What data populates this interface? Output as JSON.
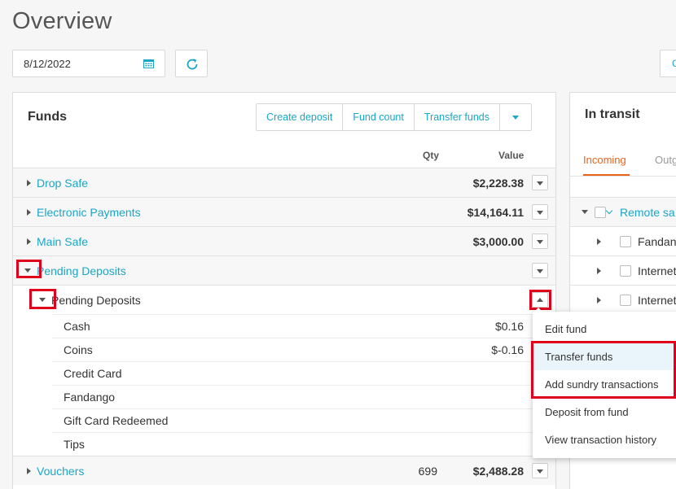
{
  "page": {
    "title": "Overview"
  },
  "toolbar": {
    "date_value": "8/12/2022",
    "edge_button_label": "C"
  },
  "funds": {
    "title": "Funds",
    "buttons": {
      "create_deposit": "Create deposit",
      "fund_count": "Fund count",
      "transfer_funds": "Transfer funds"
    },
    "columns": {
      "qty": "Qty",
      "value": "Value"
    },
    "rows": [
      {
        "label": "Drop Safe",
        "qty": "",
        "value": "$2,228.38"
      },
      {
        "label": "Electronic Payments",
        "qty": "",
        "value": "$14,164.11"
      },
      {
        "label": "Main Safe",
        "qty": "",
        "value": "$3,000.00"
      },
      {
        "label": "Pending Deposits",
        "qty": "",
        "value": ""
      }
    ],
    "sub_group": {
      "label": "Pending Deposits"
    },
    "items": [
      {
        "label": "Cash",
        "value": "$0.16"
      },
      {
        "label": "Coins",
        "value": "$-0.16"
      },
      {
        "label": "Credit Card",
        "value": ""
      },
      {
        "label": "Fandango",
        "value": ""
      },
      {
        "label": "Gift Card Redeemed",
        "value": ""
      },
      {
        "label": "Tips",
        "value": ""
      }
    ],
    "vouchers": {
      "label": "Vouchers",
      "qty": "699",
      "value": "$2,488.28"
    }
  },
  "transit": {
    "title": "In transit",
    "tabs": {
      "incoming": "Incoming",
      "outgoing": "Outg"
    },
    "group": {
      "label": "Remote sa"
    },
    "rows": [
      {
        "label": "Fandan"
      },
      {
        "label": "Internet"
      },
      {
        "label": "Internet"
      }
    ]
  },
  "menu": {
    "items": [
      {
        "label": "Edit fund"
      },
      {
        "label": "Transfer funds"
      },
      {
        "label": "Add sundry transactions"
      },
      {
        "label": "Deposit from fund"
      },
      {
        "label": "View transaction history"
      }
    ]
  },
  "colors": {
    "accent": "#1aa6c6",
    "tab_active": "#e8641b",
    "highlight": "#e0001b"
  }
}
